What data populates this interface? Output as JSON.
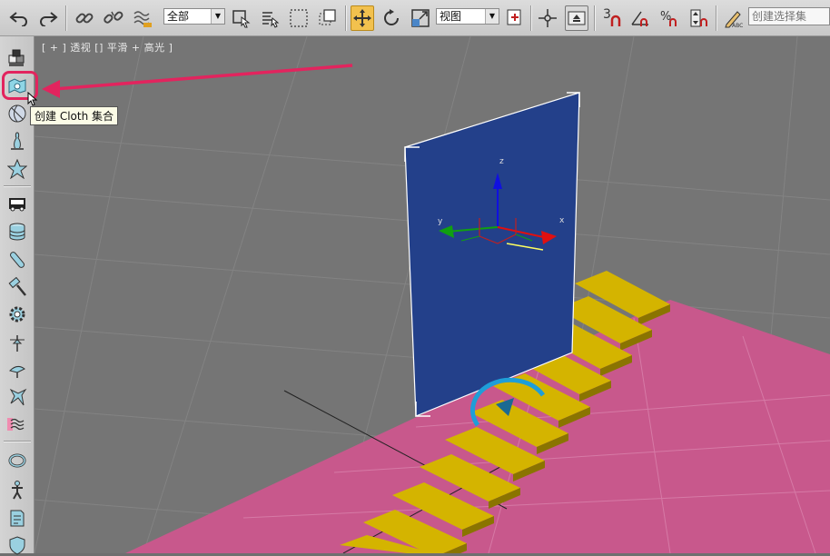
{
  "toolbar": {
    "selection_filter": "全部",
    "reference_coord": "视图",
    "snap_value": "3",
    "named_selection_placeholder": "创建选择集"
  },
  "viewport": {
    "label": "[ + ] 透视 [] 平滑 + 高光 ]",
    "gizmo_z": "z",
    "gizmo_y": "y",
    "gizmo_x": "x"
  },
  "tooltip": {
    "text": "创建 Cloth 集合"
  },
  "colors": {
    "accent_highlight": "#e2245e",
    "plane_blue": "#23408a",
    "floor_pink": "#c8588c",
    "stairs_yellow": "#d4b400",
    "active_tool": "#f2c14e"
  },
  "icons": [
    "undo-icon",
    "redo-icon",
    "link-icon",
    "unlink-icon",
    "bind-space-warp-icon",
    "select-object-icon",
    "select-by-name-icon",
    "rect-selection-icon",
    "window-crossing-icon",
    "move-icon",
    "rotate-icon",
    "scale-icon",
    "pivot-icon",
    "manipulate-icon",
    "keyboard-shortcut-icon",
    "snap-icon",
    "angle-snap-icon",
    "percent-snap-icon",
    "spinner-snap-icon",
    "edit-named-selection-icon"
  ]
}
